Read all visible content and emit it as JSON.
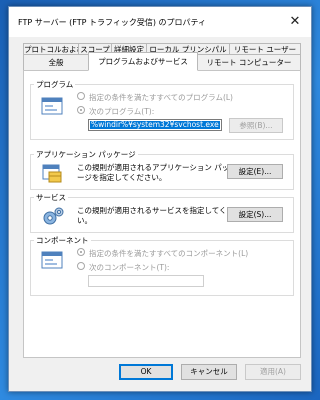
{
  "window": {
    "title": "FTP サーバー (FTP トラフィック受信) のプロパティ",
    "close_glyph": "✕"
  },
  "tabs_row1": [
    {
      "label": "プロトコルおよびポート"
    },
    {
      "label": "スコープ"
    },
    {
      "label": "詳細設定"
    },
    {
      "label": "ローカル プリンシパル"
    },
    {
      "label": "リモート ユーザー"
    }
  ],
  "tabs_row2": [
    {
      "label": "全般"
    },
    {
      "label": "プログラムおよびサービス"
    },
    {
      "label": "リモート コンピューター"
    }
  ],
  "program_group": {
    "label": "プログラム",
    "option_all": "指定の条件を満たすすべてのプログラム(L)",
    "option_this": "次のプログラム(T):",
    "path_value": "%windir%¥system32¥svchost.exe",
    "browse_label": "参照(B)..."
  },
  "package_group": {
    "label": "アプリケーション パッケージ",
    "desc_line1": "この規則が適用されるアプリケーション パッケ",
    "desc_line2": "ージを指定してください。",
    "settings_label": "設定(E)..."
  },
  "service_group": {
    "label": "サービス",
    "desc_line1": "この規則が適用されるサービスを指定してくださ",
    "desc_line2": "い。",
    "settings_label": "設定(S)..."
  },
  "component_group": {
    "label": "コンポーネント",
    "option_all": "指定の条件を満たすすべてのコンポーネント(L)",
    "option_this": "次のコンポーネント(T):"
  },
  "footer": {
    "ok_label": "OK",
    "cancel_label": "キャンセル",
    "apply_label": "適用(A)"
  },
  "colors": {
    "accent": "#0078d7",
    "desktop": "#2474c8"
  }
}
